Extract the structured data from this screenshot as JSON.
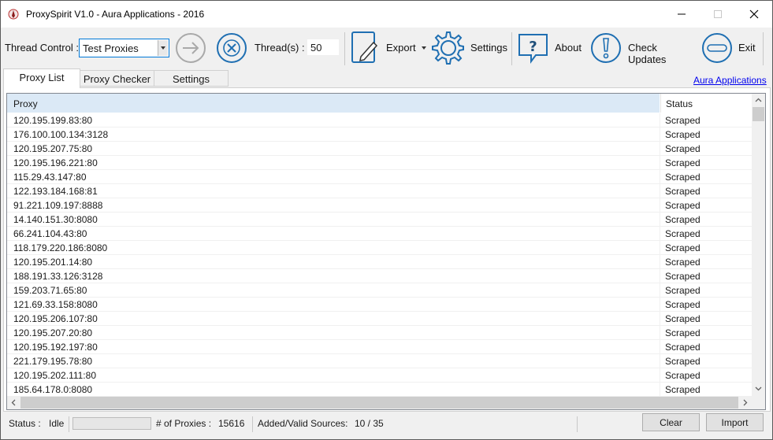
{
  "window": {
    "title": "ProxySpirit V1.0 - Aura Applications - 2016"
  },
  "toolbar": {
    "thread_control_label": "Thread Control :",
    "thread_control_value": "Test Proxies",
    "threads_label": "Thread(s) :",
    "threads_value": "50",
    "export_label": "Export",
    "settings_label": "Settings",
    "about_label": "About",
    "check_updates_label": "Check Updates",
    "exit_label": "Exit"
  },
  "tabs": [
    {
      "label": "Proxy List",
      "active": true
    },
    {
      "label": "Proxy Checker",
      "active": false
    },
    {
      "label": "Settings",
      "active": false
    }
  ],
  "aura_link": "Aura Applications",
  "list": {
    "columns": [
      "Proxy",
      "Status"
    ],
    "rows": [
      {
        "proxy": "120.195.199.83:80",
        "status": "Scraped"
      },
      {
        "proxy": "176.100.100.134:3128",
        "status": "Scraped"
      },
      {
        "proxy": "120.195.207.75:80",
        "status": "Scraped"
      },
      {
        "proxy": "120.195.196.221:80",
        "status": "Scraped"
      },
      {
        "proxy": "115.29.43.147:80",
        "status": "Scraped"
      },
      {
        "proxy": "122.193.184.168:81",
        "status": "Scraped"
      },
      {
        "proxy": "91.221.109.197:8888",
        "status": "Scraped"
      },
      {
        "proxy": "14.140.151.30:8080",
        "status": "Scraped"
      },
      {
        "proxy": "66.241.104.43:80",
        "status": "Scraped"
      },
      {
        "proxy": "118.179.220.186:8080",
        "status": "Scraped"
      },
      {
        "proxy": "120.195.201.14:80",
        "status": "Scraped"
      },
      {
        "proxy": "188.191.33.126:3128",
        "status": "Scraped"
      },
      {
        "proxy": "159.203.71.65:80",
        "status": "Scraped"
      },
      {
        "proxy": "121.69.33.158:8080",
        "status": "Scraped"
      },
      {
        "proxy": "120.195.206.107:80",
        "status": "Scraped"
      },
      {
        "proxy": "120.195.207.20:80",
        "status": "Scraped"
      },
      {
        "proxy": "120.195.192.197:80",
        "status": "Scraped"
      },
      {
        "proxy": "221.179.195.78:80",
        "status": "Scraped"
      },
      {
        "proxy": "120.195.202.111:80",
        "status": "Scraped"
      },
      {
        "proxy": "185.64.178.0:8080",
        "status": "Scraped"
      }
    ]
  },
  "statusbar": {
    "status_label": "Status :",
    "status_value": "Idle",
    "progress": 0,
    "proxies_label": "# of Proxies :",
    "proxies_value": "15616",
    "sources_label": "Added/Valid Sources:",
    "sources_value": "10 / 35",
    "clear_label": "Clear",
    "import_label": "Import"
  },
  "colors": {
    "accent": "#0078d7",
    "icon_blue": "#1f6fb2",
    "header_bg": "#dbe9f6",
    "link": "#0000ee"
  },
  "icons": {
    "app": "quill-icon",
    "start": "arrow-right-icon",
    "stop": "x-circle-icon",
    "export": "document-pen-icon",
    "settings": "gear-icon",
    "about": "question-bubble-icon",
    "updates": "exclamation-circle-icon",
    "exit": "minus-circle-icon"
  }
}
